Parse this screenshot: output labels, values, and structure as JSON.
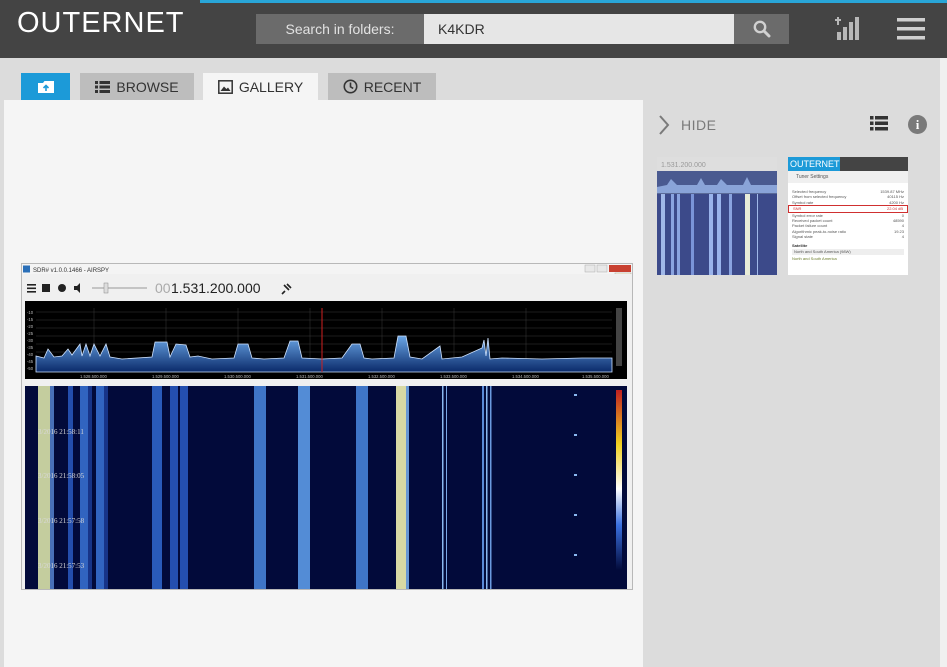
{
  "header": {
    "logo": "OUTERNET",
    "search_label": "Search in folders:",
    "search_value": "K4KDR"
  },
  "tabs": {
    "browse": "BROWSE",
    "gallery": "GALLERY",
    "recent": "RECENT"
  },
  "sidebar": {
    "hide_label": "HIDE",
    "info_glyph": "i"
  },
  "screenshot": {
    "titlebar": "SDR# v1.0.0.1466 - AIRSPY",
    "frequency_dim": "00",
    "frequency": "1.531.200.000",
    "spectrum_ticks": [
      "1.528.500.000",
      "1.529.500.000",
      "1.530.500.000",
      "1.531.500.000",
      "1.532.500.000",
      "1.533.500.000",
      "1.534.500.000",
      "1.535.500.000"
    ],
    "db_labels": [
      "-10",
      "-15",
      "-20",
      "-25",
      "-30",
      "-35",
      "-40",
      "-45",
      "-50"
    ],
    "timestamps": [
      "3/2016 21:58:11",
      "3/2016 21:58:05",
      "3/2016 21:57:58",
      "3/2016 21:57:53"
    ]
  },
  "thumbnail_1": {
    "frequency": "1.531.200.000"
  },
  "thumbnail_2": {
    "logo": "OUTERNET",
    "panel_title": "Tuner Settings",
    "rows": [
      {
        "label": "Selected frequency",
        "value": "1539.87 MHz"
      },
      {
        "label": "Offset from selected frequency",
        "value": "40115 Hz"
      },
      {
        "label": "Symbol rate",
        "value": "4200 Hz"
      },
      {
        "label": "SNR",
        "value": "22.04 dB"
      },
      {
        "label": "Symbol error rate",
        "value": "0"
      },
      {
        "label": "Received packet count",
        "value": "48590"
      },
      {
        "label": "Packet failure count",
        "value": "4"
      },
      {
        "label": "Algorithmic peak-to-noise ratio",
        "value": "19.23"
      },
      {
        "label": "Signal state",
        "value": "4"
      }
    ],
    "section_label": "Satellite",
    "select_value": "North and South America (98W)",
    "satellite_name": "North and South America"
  },
  "colors": {
    "topbar": "#444444",
    "accent": "#1c9ad8",
    "sidebar": "#dcdcdc",
    "content": "#f5f5f5"
  },
  "icons": {
    "search": "search-icon",
    "signal": "signal-bars-icon",
    "menu": "hamburger-menu-icon",
    "folder": "folder-up-icon",
    "browse": "list-icon",
    "gallery": "image-icon",
    "recent": "clock-icon",
    "hide": "chevron-right-icon",
    "list_view": "list-view-icon",
    "info": "info-icon"
  }
}
